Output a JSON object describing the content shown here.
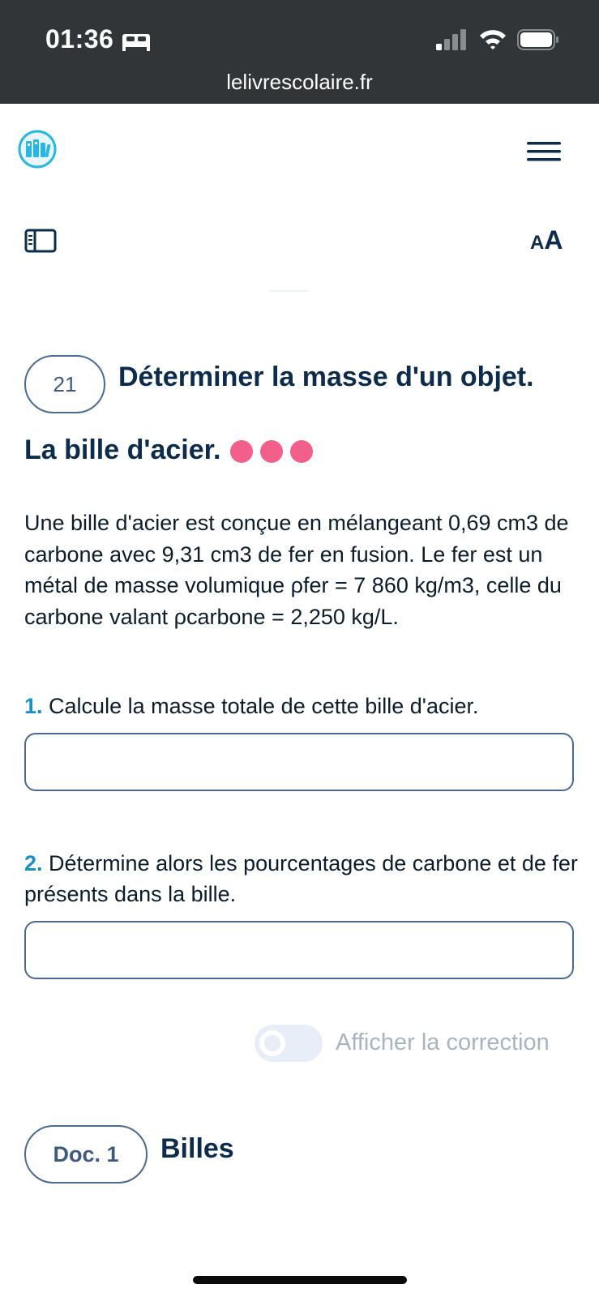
{
  "status_bar": {
    "time": "01:36",
    "url": "lelivrescolaire.fr",
    "icons": [
      "bed-icon",
      "signal-icon",
      "wifi-icon",
      "battery-icon"
    ]
  },
  "header": {
    "logo_icon": "books-logo-icon",
    "menu_icon": "hamburger-menu-icon",
    "sidebar_icon": "sidebar-toggle-icon",
    "text_size_small": "A",
    "text_size_large": "A"
  },
  "exercise": {
    "number": "21",
    "title": "Déterminer la masse d'un objet.",
    "subtitle": "La bille d'acier.",
    "difficulty_dots": 3,
    "difficulty_color": "#f25f8a",
    "statement": "Une bille d'acier est conçue en mélangeant 0,69 cm3 de carbone avec 9,31 cm3 de fer en fusion. Le fer est un métal de masse volumique ρfer = 7 860 kg/m3, celle du carbone valant ρcarbone = 2,250 kg/L.",
    "questions": [
      {
        "number": "1.",
        "text": "Calcule la masse totale de cette bille d'acier.",
        "answer_value": ""
      },
      {
        "number": "2.",
        "text": "Détermine alors les pourcentages de carbone et de fer présents dans la bille.",
        "answer_value": ""
      }
    ],
    "toggle_label": "Afficher la correction",
    "toggle_on": false
  },
  "document": {
    "badge": "Doc. 1",
    "title": "Billes"
  },
  "colors": {
    "status_bar_bg": "#323537",
    "title_text": "#0d2b4a",
    "question_number": "#1a8fc0",
    "border": "#4a6a90"
  }
}
